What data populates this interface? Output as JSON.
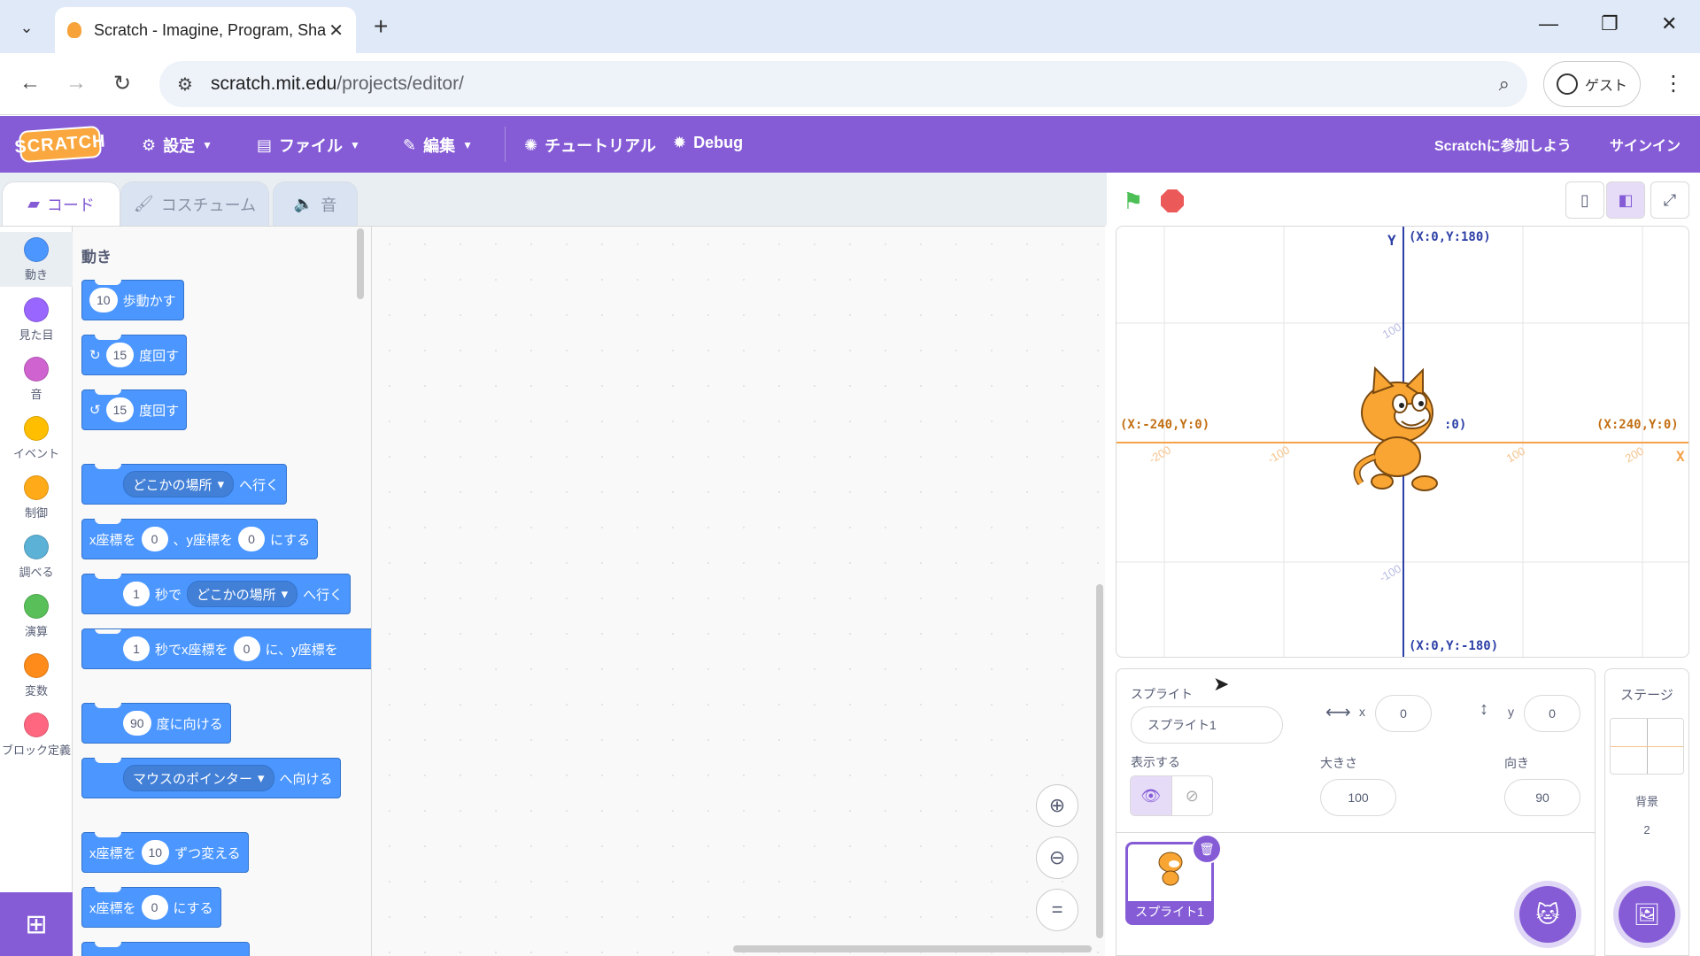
{
  "browser": {
    "tab_title": "Scratch - Imagine, Program, Sha",
    "url_host": "scratch.mit.edu",
    "url_path": "/projects/editor/",
    "profile_label": "ゲスト"
  },
  "menu": {
    "logo": "SCRATCH",
    "settings": "設定",
    "file": "ファイル",
    "edit": "編集",
    "tutorials": "チュートリアル",
    "debug": "Debug",
    "join": "Scratchに参加しよう",
    "signin": "サインイン"
  },
  "editor_tabs": {
    "code": "コード",
    "costumes": "コスチューム",
    "sounds": "音"
  },
  "categories": [
    {
      "label": "動き",
      "color": "#4c97ff"
    },
    {
      "label": "見た目",
      "color": "#9966ff"
    },
    {
      "label": "音",
      "color": "#cf63cf"
    },
    {
      "label": "イベント",
      "color": "#ffbf00"
    },
    {
      "label": "制御",
      "color": "#ffab19"
    },
    {
      "label": "調べる",
      "color": "#5cb1d6"
    },
    {
      "label": "演算",
      "color": "#59c059"
    },
    {
      "label": "変数",
      "color": "#ff8c1a"
    },
    {
      "label": "ブロック定義",
      "color": "#ff6680"
    }
  ],
  "flyout": {
    "heading": "動き",
    "move_steps": "10",
    "move_label": "歩動かす",
    "turn_right_deg": "15",
    "turn_right_label": "度回す",
    "turn_left_deg": "15",
    "turn_left_label": "度回す",
    "goto_menu": "どこかの場所",
    "goto_label": "へ行く",
    "gotoxy_x_label": "x座標を",
    "gotoxy_x": "0",
    "gotoxy_y_label": "、y座標を",
    "gotoxy_y": "0",
    "gotoxy_end": "にする",
    "glide_secs": "1",
    "glide_label": "秒で",
    "glide_menu": "どこかの場所",
    "glide_end": "へ行く",
    "glidexy_secs": "1",
    "glidexy_label": "秒でx座標を",
    "glidexy_x": "0",
    "glidexy_mid": "に、y座標を",
    "point_deg": "90",
    "point_label": "度に向ける",
    "point_toward_menu": "マウスのポインター",
    "point_toward_label": "へ向ける",
    "change_x_label": "x座標を",
    "change_x": "10",
    "change_x_end": "ずつ変える",
    "set_x_label": "x座標を",
    "set_x": "0",
    "set_x_end": "にする"
  },
  "stage": {
    "y_axis": "Y",
    "x_axis": "X",
    "top_label": "(X:0,Y:180)",
    "bottom_label": "(X:0,Y:-180)",
    "left_label": "(X:-240,Y:0)",
    "right_label": "(X:240,Y:0)",
    "center_label": ":0)",
    "x_ticks": [
      "-200",
      "-100",
      "100",
      "200"
    ],
    "y_ticks": [
      "100",
      "-100"
    ]
  },
  "sprite_info": {
    "sprite_label": "スプライト",
    "sprite_name": "スプライト1",
    "x_label": "x",
    "x_value": "0",
    "y_label": "y",
    "y_value": "0",
    "show_label": "表示する",
    "size_label": "大きさ",
    "size_value": "100",
    "direction_label": "向き",
    "direction_value": "90",
    "thumb_name": "スプライト1"
  },
  "stage_pane": {
    "title": "ステージ",
    "backdrop_label": "背景",
    "backdrop_count": "2"
  }
}
